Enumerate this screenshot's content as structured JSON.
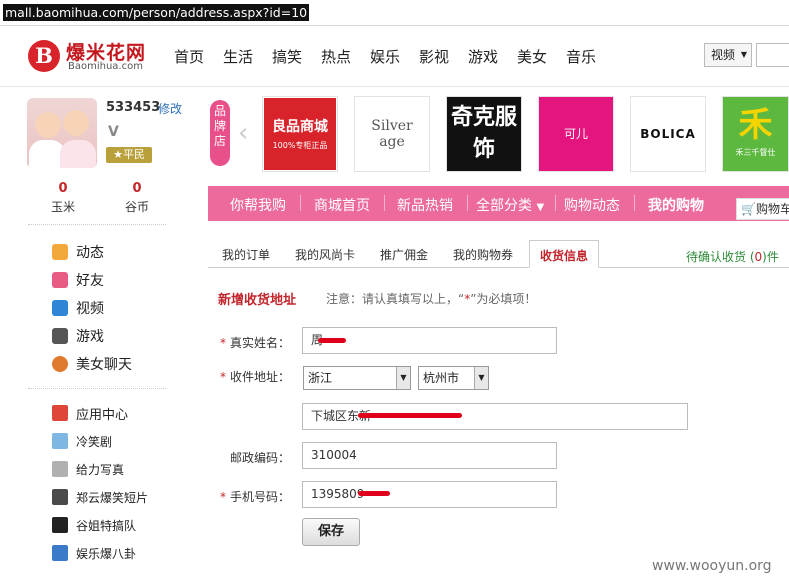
{
  "url": "mall.baomihua.com/person/address.aspx?id=10",
  "logo": {
    "cn": "爆米花网",
    "en": "Baomihua.com",
    "mark": "B"
  },
  "nav": [
    "首页",
    "生活",
    "搞笑",
    "热点",
    "娱乐",
    "影视",
    "游戏",
    "美女",
    "音乐"
  ],
  "search_select": "视频",
  "user": {
    "name": "533453",
    "edit": "修改",
    "level_mark": "V",
    "badge": "平民"
  },
  "stats": [
    {
      "value": "0",
      "label": "玉米"
    },
    {
      "value": "0",
      "label": "谷币"
    }
  ],
  "menu": [
    "动态",
    "好友",
    "视频",
    "游戏",
    "美女聊天"
  ],
  "apps": [
    "应用中心",
    "冷笑剧",
    "给力写真",
    "郑云爆笑短片",
    "谷姐特搞队",
    "娱乐爆八卦"
  ],
  "brand_tag": "品牌店",
  "brands": [
    {
      "name": "良品商城",
      "sub": "100%专柜正品"
    },
    {
      "name": "Silver age",
      "sub": ""
    },
    {
      "name": "奇克服饰",
      "sub": ""
    },
    {
      "name": "可儿",
      "sub": ""
    },
    {
      "name": "BOLICA",
      "sub": ""
    },
    {
      "name": "禾",
      "sub": "禾三千督仕"
    }
  ],
  "shop_nav": [
    "你帮我购",
    "商城首页",
    "新品热销",
    "全部分类",
    "购物动态",
    "我的购物"
  ],
  "cart": "购物车",
  "tabs": [
    "我的订单",
    "我的风尚卡",
    "推广佣金",
    "我的购物券",
    "收货信息"
  ],
  "pending": {
    "prefix": "待确认收货 (",
    "count": "0",
    "suffix": ")件"
  },
  "form": {
    "title": "新增收货地址",
    "note_prefix": "注意：请认真填写以上，“",
    "note_star": "*",
    "note_suffix": "”为必填项！",
    "name_label": "真实姓名：",
    "name_value": "周",
    "addr_label": "收件地址：",
    "province": "浙江",
    "city": "杭州市",
    "street": "下城区东新",
    "zip_label": "邮政编码：",
    "zip_value": "310004",
    "phone_label": "手机号码：",
    "phone_value": "1395809",
    "save": "保存"
  },
  "watermark": "www.wooyun.org",
  "colors": {
    "pink": "#ec6b9c",
    "red": "#c2262d",
    "brand_red": "#d8232a"
  }
}
